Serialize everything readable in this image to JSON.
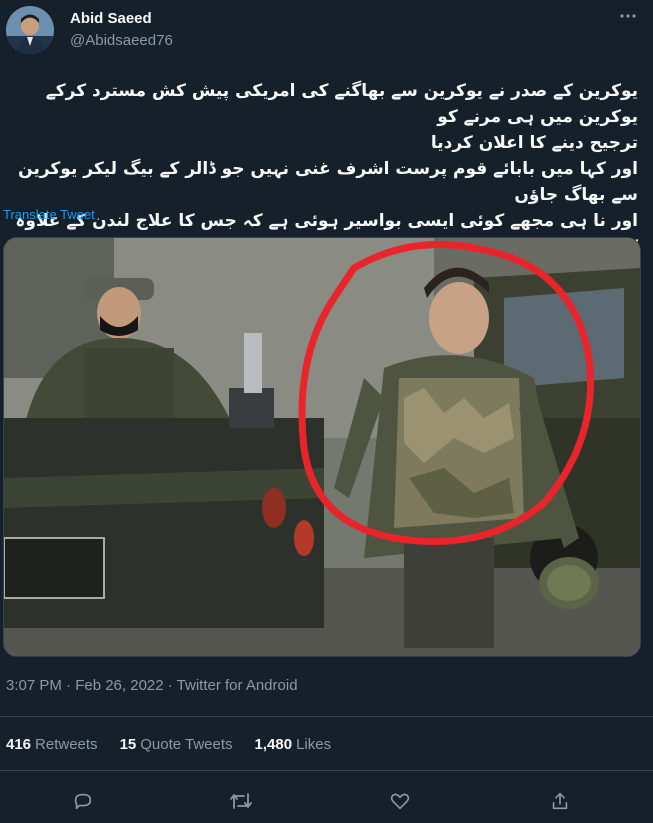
{
  "author": {
    "name": "Abid Saeed",
    "handle": "@Abidsaeed76"
  },
  "tweet": {
    "text": "یوکرین کے صدر نے یوکرین سے بھاگنے کی امریکی پیش کش مسترد کرکے یوکرین میں ہی مرنے کو\nترجیح دینے کا اعلان کردیا\nاور کہا میں بابائے قوم پرست اشرف غنی نہیں جو ڈالر کے بیگ لیکر یوکرین سے بھاگ جاؤں\nاور نا ہی مجھے کوئی ایسی بواسیر ہوئی ہے کہ جس کا علاج لندن کے علاوہ کہیں اور ممکن نہیں",
    "translate_label": "Translate Tweet",
    "meta": "3:07 PM · Feb 26, 2022 · Twitter for Android"
  },
  "stats": {
    "retweets_count": "416",
    "retweets_label": "Retweets",
    "quotes_count": "15",
    "quotes_label": "Quote Tweets",
    "likes_count": "1,480",
    "likes_label": "Likes"
  },
  "icons": {
    "more": "more-icon",
    "reply": "reply-icon",
    "retweet": "retweet-icon",
    "like": "like-icon",
    "share": "share-icon"
  },
  "colors": {
    "background": "#15202b",
    "text_primary": "#f7f9f9",
    "text_secondary": "#8b98a5",
    "link": "#1d9bf0",
    "border": "#38444d",
    "annotation_red": "#e8252a"
  }
}
